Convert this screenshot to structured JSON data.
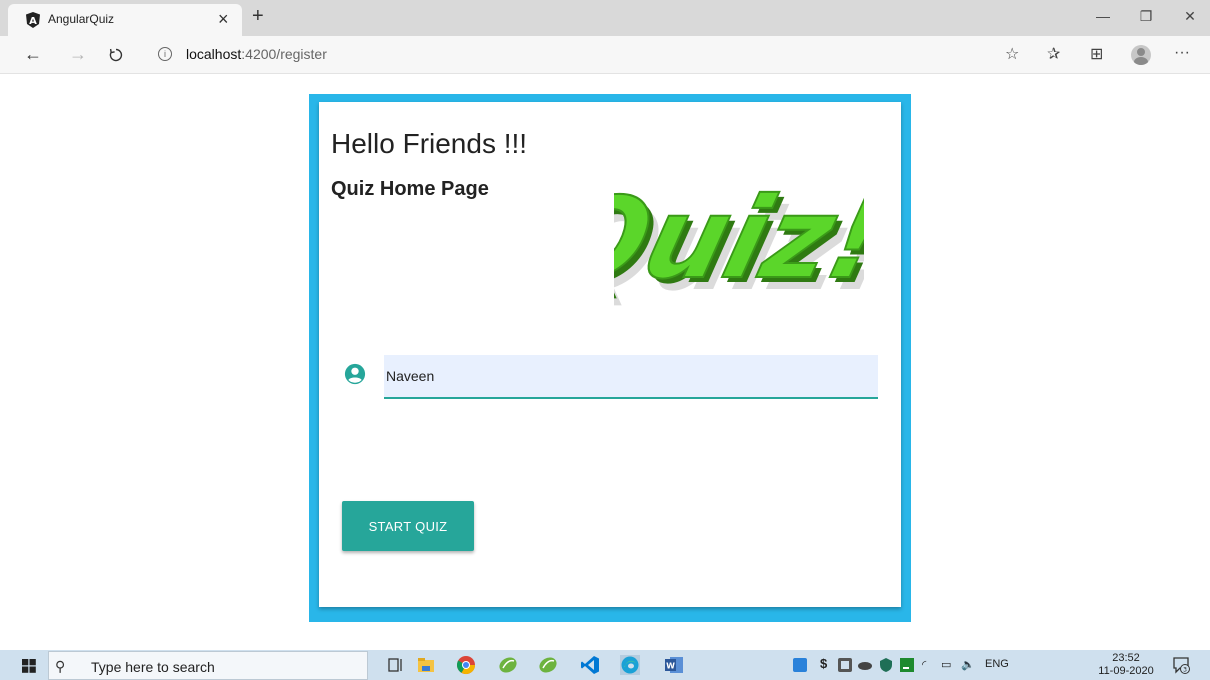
{
  "browser": {
    "tab_title": "AngularQuiz",
    "tab_close": "×",
    "new_tab": "+",
    "url_host": "localhost",
    "url_rest": ":4200/register",
    "window": {
      "minimize": "—",
      "restore": "❐",
      "close": "✕"
    },
    "toolbar_icons": {
      "favorite": "☆",
      "favorites": "✰",
      "collections": "⊞",
      "more": "···"
    }
  },
  "page": {
    "heading": "Hello Friends !!!",
    "subheading": "Quiz Home Page",
    "logo_text": "Quiz!",
    "name_input_value": "Naveen",
    "start_button": "START QUIZ",
    "colors": {
      "frame": "#29b6e9",
      "accent": "#26a69a",
      "input_bg": "#e8f0fe",
      "logo_green": "#5bd62a"
    }
  },
  "taskbar": {
    "search_placeholder": "Type here to search",
    "language": "ENG",
    "time": "23:52",
    "date": "11-09-2020",
    "notification_count": "3"
  }
}
